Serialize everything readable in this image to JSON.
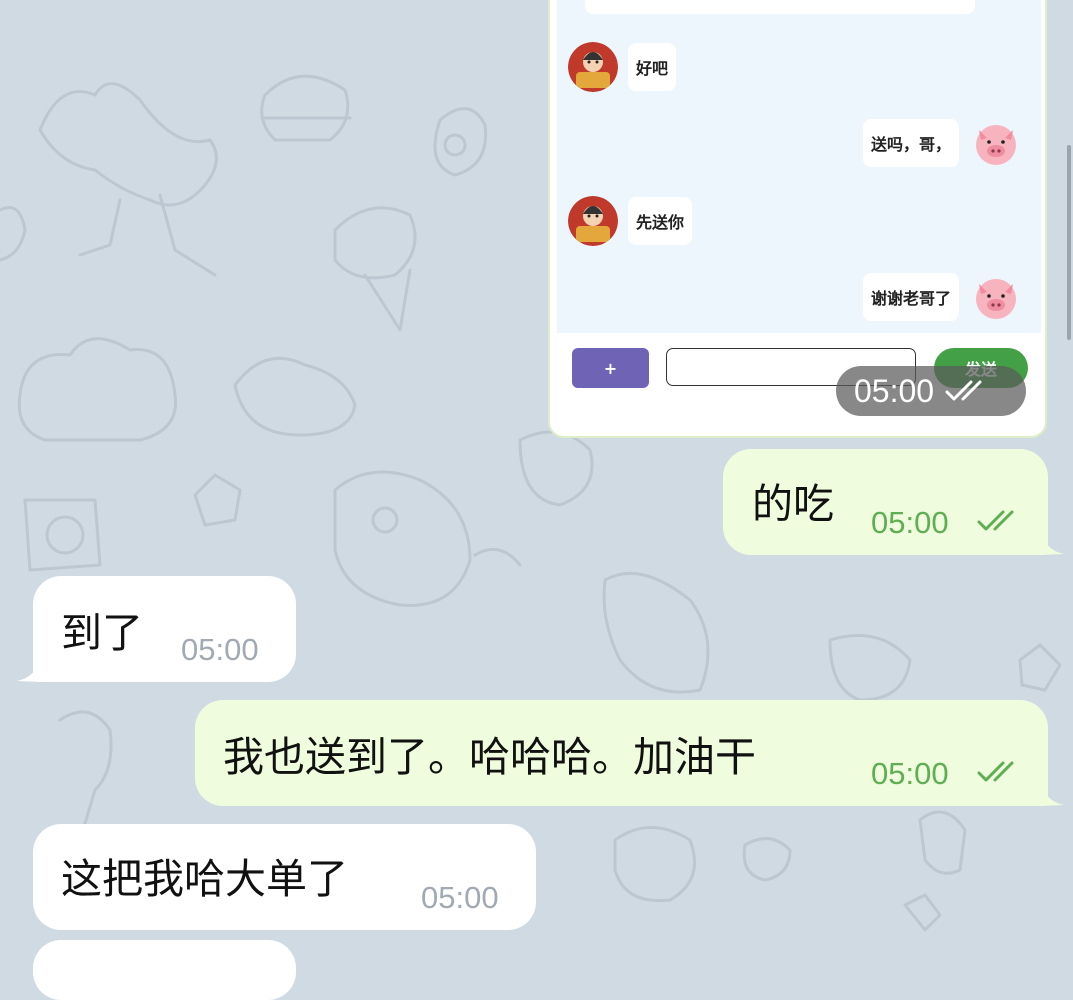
{
  "screenshot_card": {
    "messages": [
      {
        "side": "left",
        "avatar": "fortune-god-avatar",
        "text": "好吧"
      },
      {
        "side": "right",
        "avatar": "pig-avatar",
        "text": "送吗，哥，"
      },
      {
        "side": "left",
        "avatar": "fortune-god-avatar",
        "text": "先送你"
      },
      {
        "side": "right",
        "avatar": "pig-avatar",
        "text": "谢谢老哥了"
      }
    ],
    "plus_label": "+",
    "send_label": "发送",
    "timestamp": "05:00"
  },
  "messages": [
    {
      "side": "out",
      "text": "的吃",
      "time": "05:00",
      "status_icon": "double-check-icon"
    },
    {
      "side": "in",
      "text": "到了",
      "time": "05:00"
    },
    {
      "side": "out",
      "text": "我也送到了。哈哈哈。加油干",
      "time": "05:00",
      "status_icon": "double-check-icon"
    },
    {
      "side": "in",
      "text": "这把我哈大单了",
      "time": "05:00"
    }
  ],
  "colors": {
    "background": "#d0dae3",
    "incoming_bubble": "#ffffff",
    "outgoing_bubble": "#effdde",
    "outgoing_time": "#5fae52",
    "incoming_time": "#a1aab3",
    "send_button": "#43a047",
    "plus_button": "#6f63b6"
  }
}
